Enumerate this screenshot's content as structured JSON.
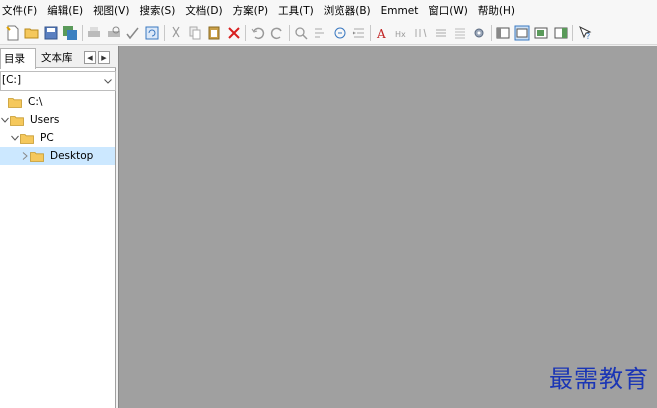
{
  "menubar": {
    "items": [
      "文件(F)",
      "编辑(E)",
      "视图(V)",
      "搜索(S)",
      "文档(D)",
      "方案(P)",
      "工具(T)",
      "浏览器(B)",
      "Emmet",
      "窗口(W)",
      "帮助(H)"
    ]
  },
  "toolbar": {
    "icons": [
      "new-file-icon",
      "open-folder-icon",
      "save-icon",
      "save-all-icon",
      "print-icon",
      "print-preview-icon",
      "spellcheck-icon",
      "refresh-icon",
      "cut-icon",
      "copy-icon",
      "paste-icon",
      "delete-icon",
      "undo-icon",
      "redo-icon",
      "find-icon",
      "replace-icon",
      "goto-icon",
      "indent-icon",
      "font-icon",
      "hex-icon",
      "wrap-icon",
      "justify-icon",
      "list-icon",
      "settings-icon",
      "panel-left-icon",
      "panel-active-icon",
      "panel-output-icon",
      "panel-right-icon",
      "help-icon"
    ]
  },
  "sidebar": {
    "tabs": {
      "directory": "目录",
      "text_library": "文本库"
    },
    "drive_value": "[C:]",
    "tree": [
      {
        "label": "C:\\",
        "level": 0,
        "expanded": null,
        "selected": false
      },
      {
        "label": "Users",
        "level": 0,
        "expanded": true,
        "selected": false
      },
      {
        "label": "PC",
        "level": 1,
        "expanded": true,
        "selected": false
      },
      {
        "label": "Desktop",
        "level": 2,
        "expanded": false,
        "selected": true
      }
    ]
  },
  "watermark": {
    "text": "最需教育"
  },
  "colors": {
    "selection": "#cce8ff",
    "workspace": "#a0a0a0",
    "watermark": "#1a35b5",
    "folder": "#f5c85c"
  }
}
